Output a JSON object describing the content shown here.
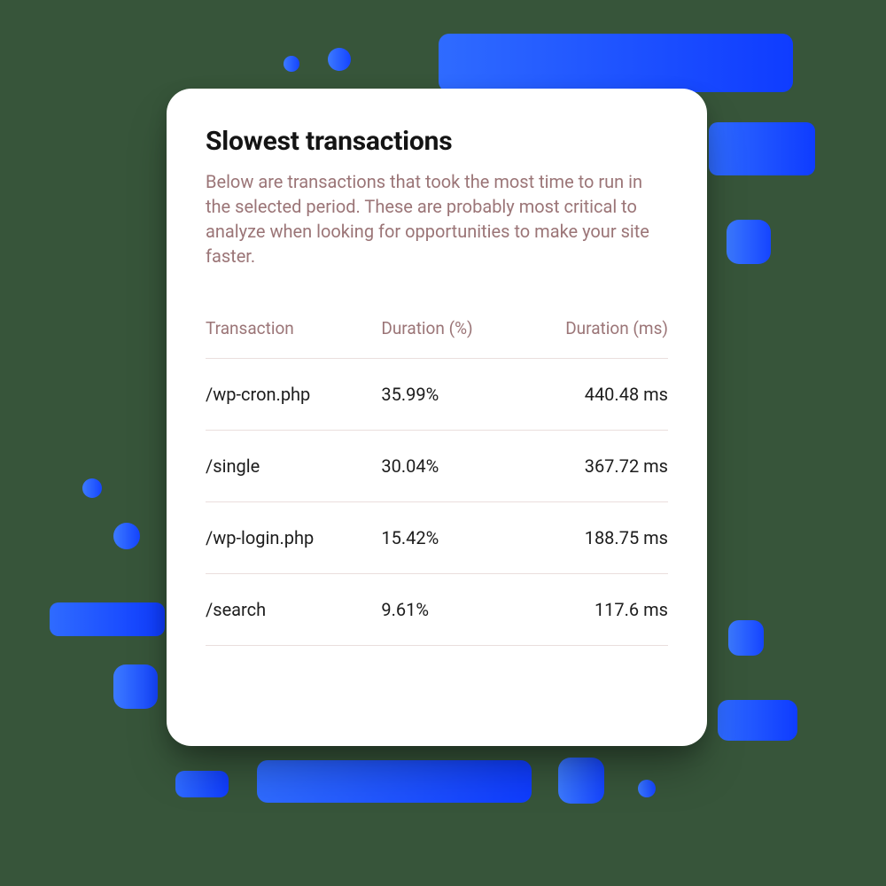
{
  "card": {
    "title": "Slowest transactions",
    "description": "Below are transactions that took the most time to run in the selected period. These are probably most critical to analyze when looking for opportunities to make your site faster."
  },
  "table": {
    "headers": {
      "transaction": "Transaction",
      "duration_pct": "Duration (%)",
      "duration_ms": "Duration (ms)"
    },
    "rows": [
      {
        "transaction": "/wp-cron.php",
        "duration_pct": "35.99%",
        "duration_ms": "440.48 ms"
      },
      {
        "transaction": "/single",
        "duration_pct": "30.04%",
        "duration_ms": "367.72 ms"
      },
      {
        "transaction": "/wp-login.php",
        "duration_pct": "15.42%",
        "duration_ms": "188.75 ms"
      },
      {
        "transaction": "/search",
        "duration_pct": "9.61%",
        "duration_ms": "117.6 ms"
      }
    ]
  }
}
